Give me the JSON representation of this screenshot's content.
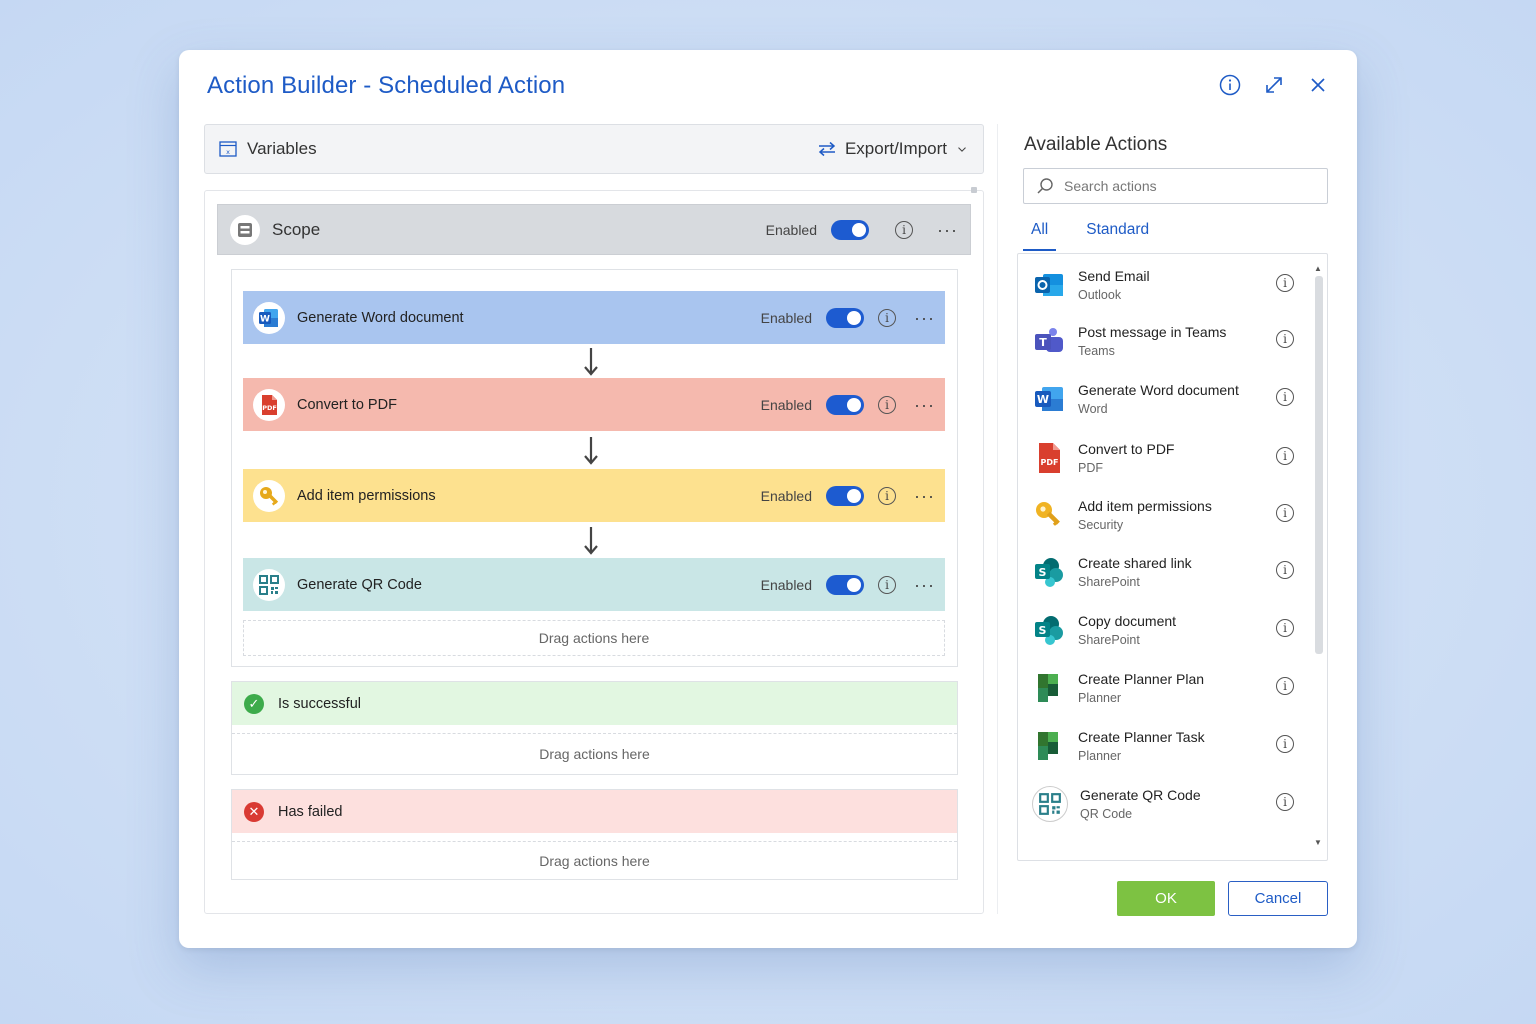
{
  "dialog": {
    "title": "Action Builder - Scheduled Action",
    "header_icons": [
      "info-icon",
      "expand-icon",
      "close-icon"
    ]
  },
  "variables_bar": {
    "label": "Variables",
    "export_label": "Export/Import"
  },
  "scope": {
    "label": "Scope",
    "enabled_label": "Enabled",
    "enabled": true
  },
  "actions": [
    {
      "label": "Generate Word document",
      "enabled_label": "Enabled",
      "enabled": true,
      "color": "#a9c5ef",
      "icon": "word-icon"
    },
    {
      "label": "Convert to PDF",
      "enabled_label": "Enabled",
      "enabled": true,
      "color": "#f5b9ae",
      "icon": "pdf-icon"
    },
    {
      "label": "Add item permissions",
      "enabled_label": "Enabled",
      "enabled": true,
      "color": "#fde18f",
      "icon": "key-icon"
    },
    {
      "label": "Generate QR Code",
      "enabled_label": "Enabled",
      "enabled": true,
      "color": "#c9e6e6",
      "icon": "qr-code-icon"
    }
  ],
  "drop_zone_label": "Drag actions here",
  "branches": {
    "success": {
      "label": "Is successful",
      "color": "#e2f7e1",
      "icon": "check-circle-icon"
    },
    "failed": {
      "label": "Has failed",
      "color": "#fde0de",
      "icon": "x-circle-icon"
    }
  },
  "available": {
    "title": "Available Actions",
    "search_placeholder": "Search actions",
    "tabs": [
      {
        "label": "All",
        "active": true
      },
      {
        "label": "Standard",
        "active": false
      }
    ],
    "items": [
      {
        "name": "Send Email",
        "sub": "Outlook",
        "icon": "outlook-icon"
      },
      {
        "name": "Post message in Teams",
        "sub": "Teams",
        "icon": "teams-icon"
      },
      {
        "name": "Generate Word document",
        "sub": "Word",
        "icon": "word-icon"
      },
      {
        "name": "Convert to PDF",
        "sub": "PDF",
        "icon": "pdf-icon"
      },
      {
        "name": "Add item permissions",
        "sub": "Security",
        "icon": "key-icon"
      },
      {
        "name": "Create shared link",
        "sub": "SharePoint",
        "icon": "sharepoint-icon"
      },
      {
        "name": "Copy document",
        "sub": "SharePoint",
        "icon": "sharepoint-icon"
      },
      {
        "name": "Create Planner Plan",
        "sub": "Planner",
        "icon": "planner-icon"
      },
      {
        "name": "Create Planner Task",
        "sub": "Planner",
        "icon": "planner-icon"
      },
      {
        "name": "Generate QR Code",
        "sub": "QR Code",
        "icon": "qr-code-icon"
      }
    ]
  },
  "buttons": {
    "ok": "OK",
    "cancel": "Cancel"
  },
  "colors": {
    "accent": "#1e5bc6",
    "toggle_on": "#1d5bd0",
    "ok_button": "#7dc242"
  }
}
